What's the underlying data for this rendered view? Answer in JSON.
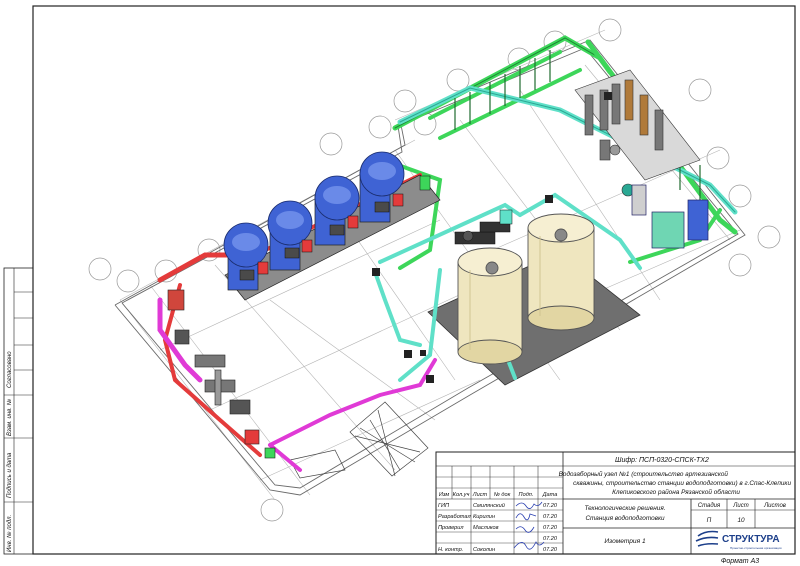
{
  "stamp": {
    "code": "Шифр: ПСП-0320-СПСК-ТХ2",
    "project": [
      "Водозаборный узел №1 (строительство артезианской",
      "скважины, строительство станции водоподготовки) в г.Спас-Клепики",
      "Клепиковского района Рязанской области"
    ],
    "section": [
      "Технологические решения.",
      "Станция водоподготовки"
    ],
    "drawing_title": "Изометрия 1",
    "col_headers": [
      "Изм",
      "Кол.уч",
      "Лист",
      "№ док",
      "Подп.",
      "Дата"
    ],
    "roles": [
      {
        "role": "ГИП",
        "name": "Смилянский",
        "date": "07.20"
      },
      {
        "role": "Разработал",
        "name": "Кирилин",
        "date": "07.20"
      },
      {
        "role": "Проверил",
        "name": "Масликов",
        "date": "07.20"
      },
      {
        "role": "",
        "name": "",
        "date": "07.20"
      },
      {
        "role": "Н. контр.",
        "name": "Соколин",
        "date": "07.20"
      }
    ],
    "stage_header": "Стадия",
    "sheet_header": "Лист",
    "sheets_header": "Листов",
    "stage": "П",
    "sheet": "10",
    "sheets": "",
    "company": "СТРУКТУРА",
    "company_tagline": "Проектно-строительная организация",
    "format": "Формат А3"
  },
  "side_strip": {
    "agreed": "Согласовано",
    "inv_vzam": "Взам. инв. №",
    "sign_date": "Подпись и дата",
    "inv_podl": "Инв. № подл."
  },
  "colors": {
    "green_pipe": "#3dd65a",
    "cyan_pipe": "#5fe0c8",
    "red_pipe": "#e43b3b",
    "magenta_pipe": "#e03ad6",
    "tank_blue": "#3f63d4",
    "tank_cream": "#efe6bf"
  }
}
